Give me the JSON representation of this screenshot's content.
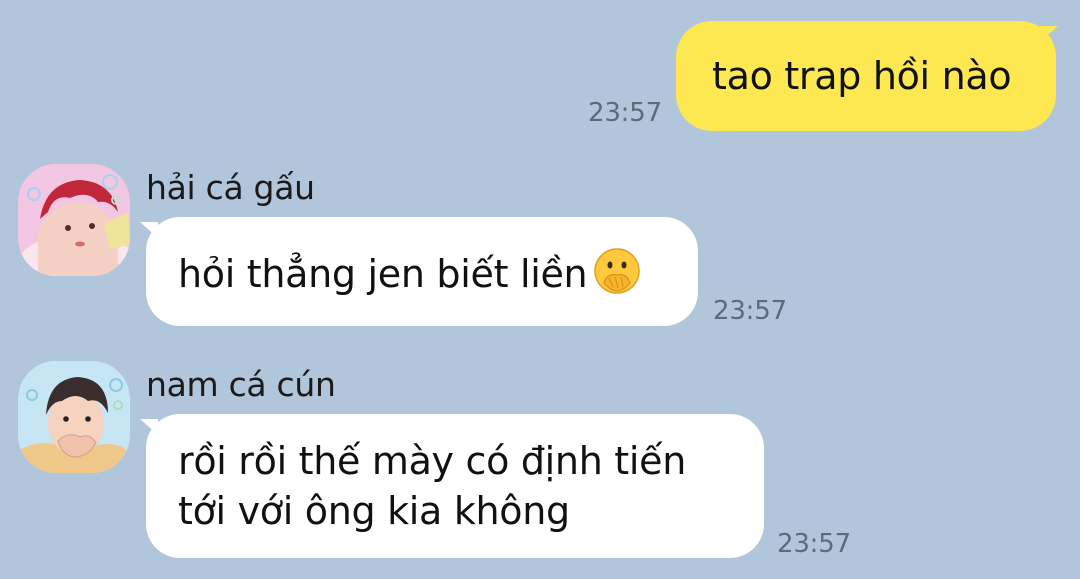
{
  "messages": [
    {
      "id": "m1",
      "direction": "outgoing",
      "text": "tao trap hồi nào",
      "time": "23:57"
    },
    {
      "id": "m2",
      "direction": "incoming",
      "sender": "hải cá gấu",
      "text": "hỏi thẳng jen biết liền",
      "emoji": "face-with-hand-over-mouth-icon",
      "time": "23:57"
    },
    {
      "id": "m3",
      "direction": "incoming",
      "sender": "nam cá cún",
      "text_lines": [
        "rồi rồi thế mày có định tiến",
        "tới với ông kia không"
      ],
      "time": "23:57"
    }
  ],
  "colors": {
    "background": "#b2c6db",
    "outgoing_bubble": "#fee851",
    "incoming_bubble": "#ffffff",
    "timestamp": "#5f6b78"
  }
}
